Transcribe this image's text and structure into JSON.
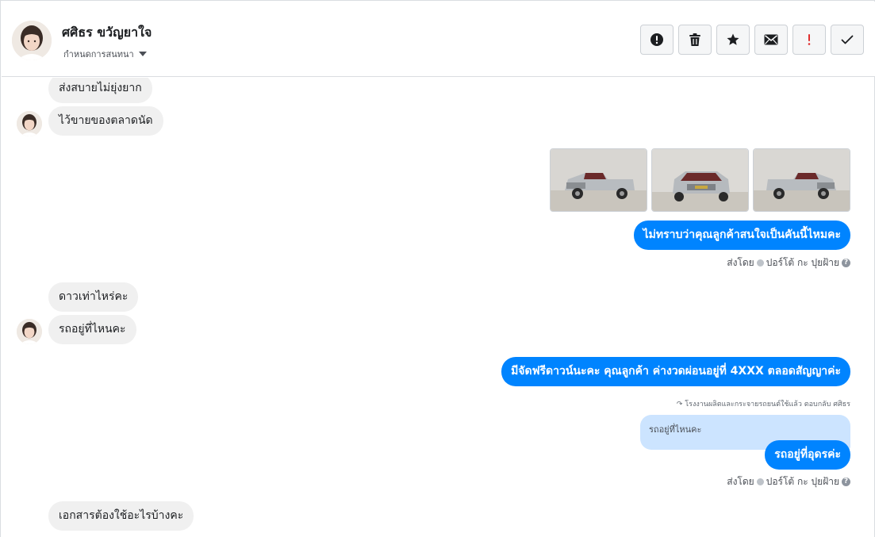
{
  "header": {
    "contact_name": "ศศิธร ขวัญยาใจ",
    "subtitle": "กำหนดการสนทนา",
    "toolbar": [
      {
        "icon": "alert-circle-icon",
        "action": "report"
      },
      {
        "icon": "trash-icon",
        "action": "delete"
      },
      {
        "icon": "star-icon",
        "action": "star"
      },
      {
        "icon": "envelope-icon",
        "action": "mark-unread"
      },
      {
        "icon": "exclamation-icon",
        "action": "mark-spam"
      },
      {
        "icon": "checkmark-icon",
        "action": "mark-done"
      }
    ]
  },
  "messages": {
    "in_1": "ส่งสบายไม่ยุ่งยาก",
    "in_2": "ไว้ขายของตลาดนัด",
    "photos": [
      "truck-front-left-photo",
      "truck-front-photo",
      "truck-front-right-photo"
    ],
    "out_1": "ไม่ทราบว่าคุณลูกค้าสนใจเป็นคันนี้ไหมคะ",
    "sent_by_1": {
      "prefix": "ส่งโดย",
      "name": "ปอร์โต้ กะ ปุยฝ้าย"
    },
    "in_3": "ดาวเท่าไหร่คะ",
    "in_4": "รถอยู่ที่ไหนคะ",
    "out_2": "มีจัดฟรีดาวน์นะคะ คุณลูกค้า ค่างวดผ่อนอยู่ที่ 4XXX ตลอดสัญญาค่ะ",
    "reply_note": "โรงงานผลิตและกระจายรถยนต์ใช้แล้ว ตอบกลับ ศศิธร",
    "quoted_text": "รถอยู่ที่ไหนคะ",
    "out_3": "รถอยู่ที่อุดรค่ะ",
    "sent_by_2": {
      "prefix": "ส่งโดย",
      "name": "ปอร์โต้ กะ ปุยฝ้าย"
    },
    "in_5": "เอกสารต้องใช้อะไรบ้างคะ"
  },
  "colors": {
    "outgoing_bubble": "#0084ff",
    "incoming_bubble": "#f0f0f0",
    "quoted_bubble": "#cce4ff",
    "spam_red": "#e02d2d"
  }
}
